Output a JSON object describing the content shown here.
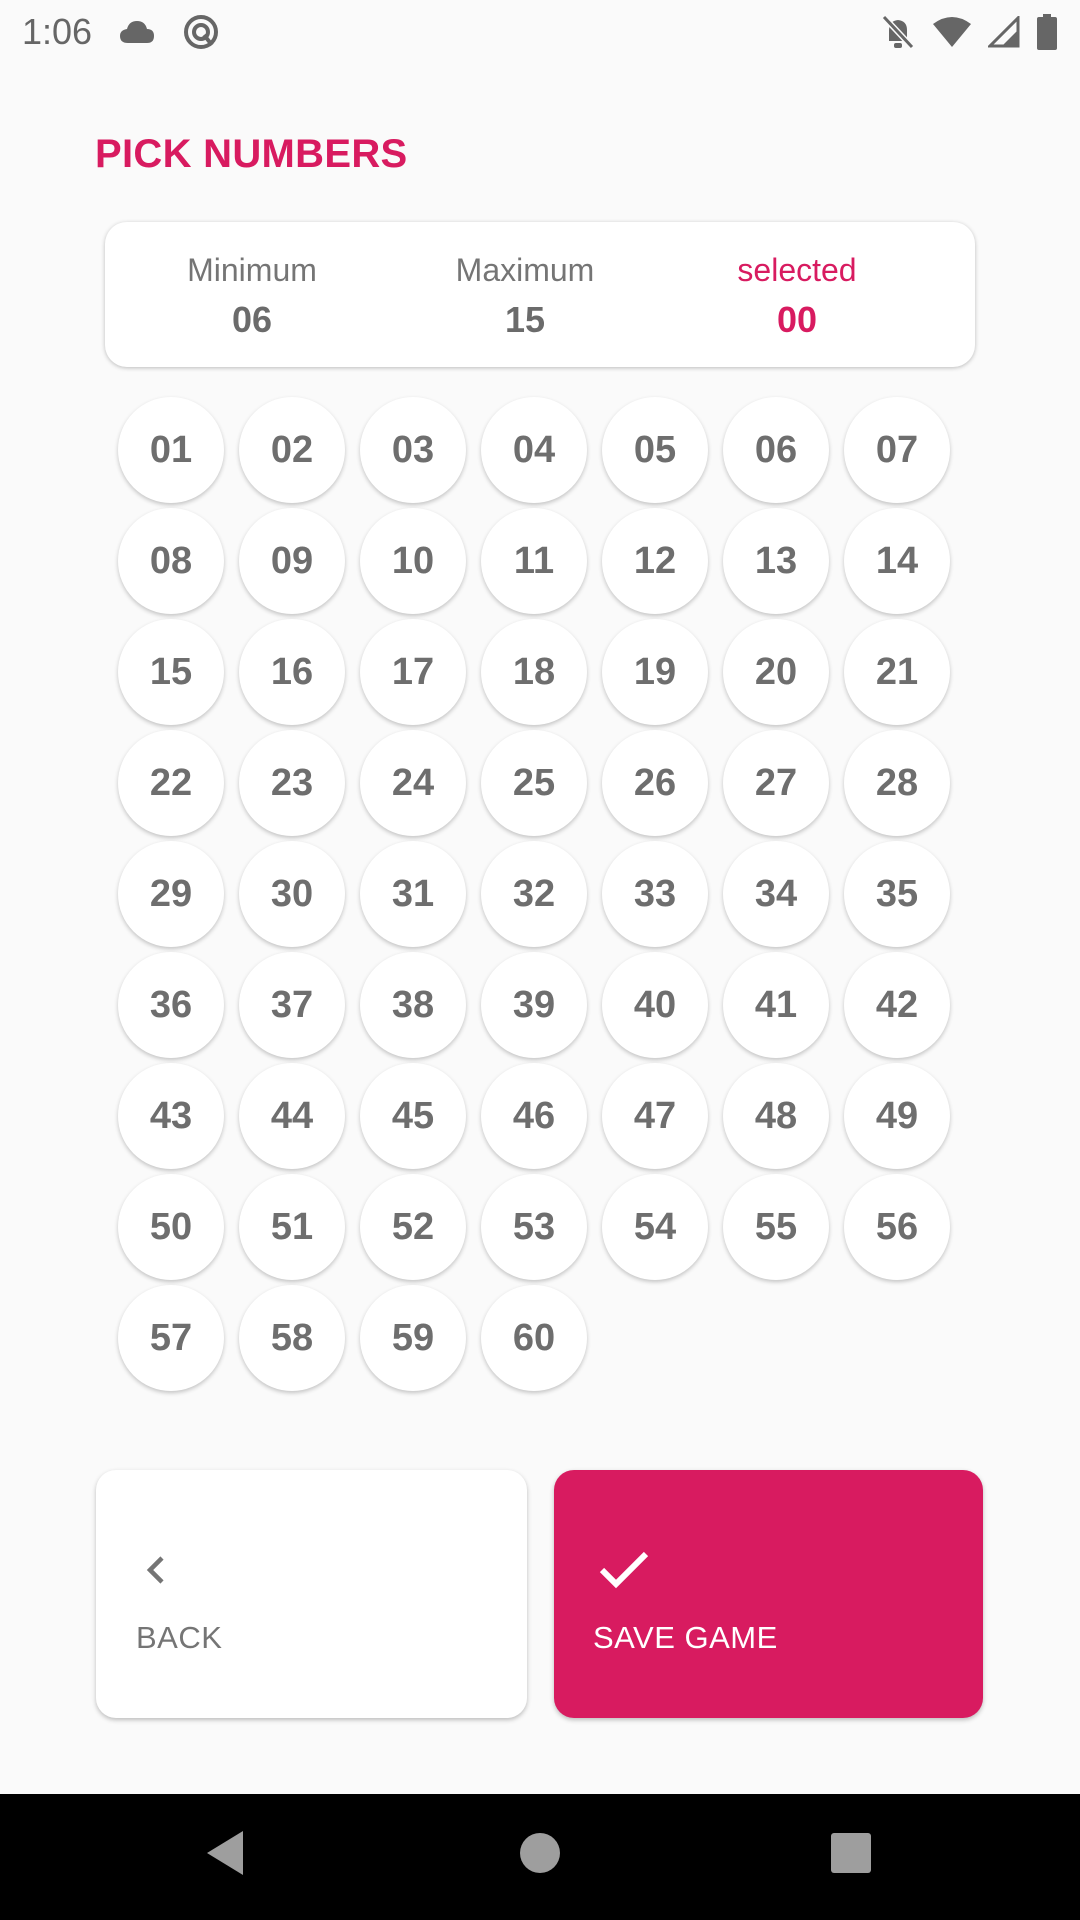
{
  "status_bar": {
    "time": "1:06",
    "left_icons": [
      "cloud-icon",
      "sync-icon"
    ],
    "right_icons": [
      "notifications-off-icon",
      "wifi-icon",
      "signal-icon",
      "battery-icon"
    ]
  },
  "page": {
    "title": "PICK NUMBERS"
  },
  "summary": {
    "minimum_label": "Minimum",
    "minimum_value": "06",
    "maximum_label": "Maximum",
    "maximum_value": "15",
    "selected_label": "selected",
    "selected_value": "00"
  },
  "numbers": [
    "01",
    "02",
    "03",
    "04",
    "05",
    "06",
    "07",
    "08",
    "09",
    "10",
    "11",
    "12",
    "13",
    "14",
    "15",
    "16",
    "17",
    "18",
    "19",
    "20",
    "21",
    "22",
    "23",
    "24",
    "25",
    "26",
    "27",
    "28",
    "29",
    "30",
    "31",
    "32",
    "33",
    "34",
    "35",
    "36",
    "37",
    "38",
    "39",
    "40",
    "41",
    "42",
    "43",
    "44",
    "45",
    "46",
    "47",
    "48",
    "49",
    "50",
    "51",
    "52",
    "53",
    "54",
    "55",
    "56",
    "57",
    "58",
    "59",
    "60"
  ],
  "actions": {
    "back_label": "BACK",
    "back_icon": "chevron-left-icon",
    "save_label": "SAVE GAME",
    "save_icon": "check-icon"
  },
  "nav": {
    "icons": [
      "back-triangle-icon",
      "home-circle-icon",
      "recents-square-icon"
    ]
  },
  "colors": {
    "accent": "#d81b60",
    "background": "#fafafa",
    "number_text": "#6e6e6e"
  }
}
